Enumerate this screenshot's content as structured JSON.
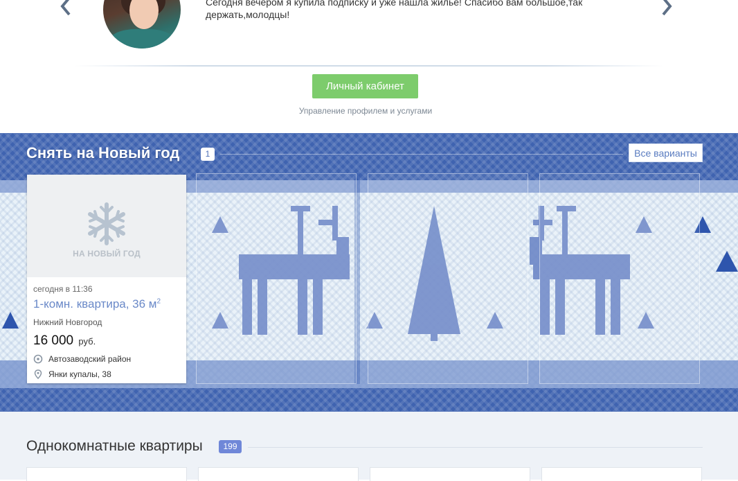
{
  "testimonial": {
    "quote": "Сегодня вечером я купила подписку и уже нашла жилье! Спасибо вам большое,так держать,молодцы!",
    "prev_icon": "chevron-left-icon",
    "next_icon": "chevron-right-icon"
  },
  "cabinet": {
    "button_label": "Личный кабинет",
    "subtitle": "Управление профилем и услугами",
    "accent_color": "#7dcc6c"
  },
  "holiday": {
    "title": "Снять на Новый год",
    "count": "1",
    "all_button": "Все варианты",
    "card": {
      "photo_icon": "snowflake-icon",
      "photo_label": "НА НОВЫЙ ГОД",
      "date": "сегодня в 11:36",
      "title": "1-комн. квартира, 36 м",
      "title_sup": "2",
      "city": "Нижний Новгород",
      "price": "16 000",
      "currency": "руб.",
      "district_icon": "target-icon",
      "district": "Автозаводский район",
      "address_icon": "map-pin-icon",
      "address": "Янки купалы, 38"
    }
  },
  "one_room": {
    "title": "Однокомнатные квартиры",
    "count": "199"
  },
  "colors": {
    "knit_blue": "#3f63b0",
    "knit_light": "#e9f2f9",
    "link_blue": "#6a89c8",
    "badge_blue": "#6f87d8"
  }
}
